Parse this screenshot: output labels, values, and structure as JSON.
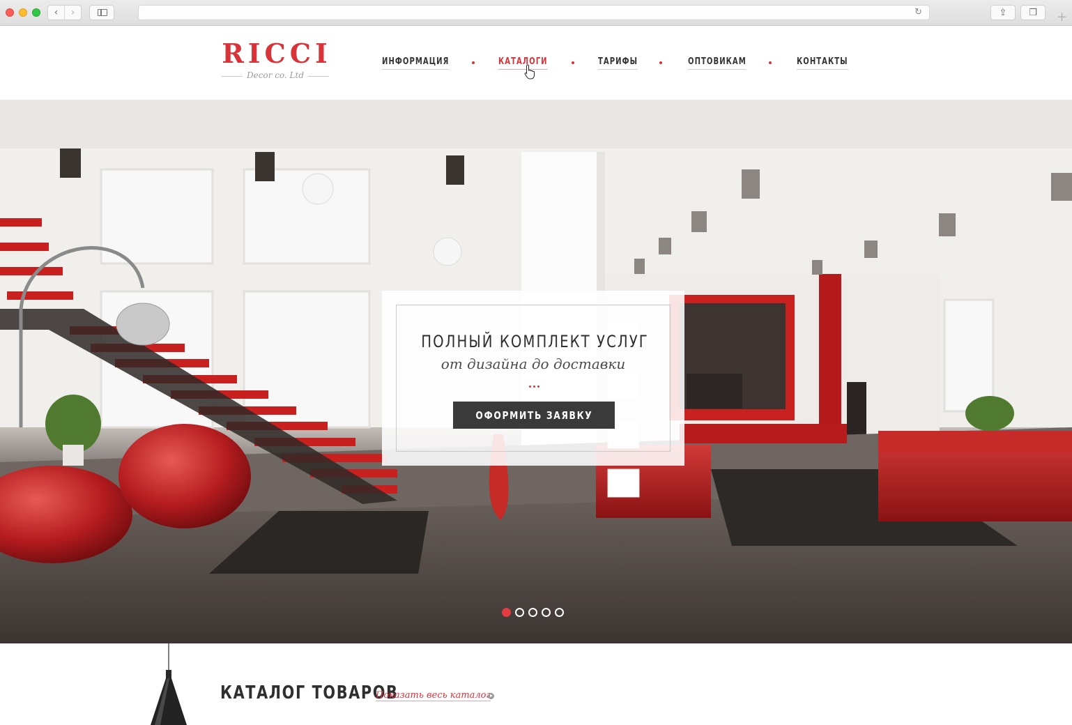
{
  "browser": {
    "address_value": "",
    "nav_back_icon": "chevron-left-icon",
    "nav_forward_icon": "chevron-right-icon",
    "reload_icon": "reload-icon",
    "share_icon": "share-icon",
    "tabs_icon": "tabs-icon",
    "new_tab_icon": "plus-icon"
  },
  "brand": {
    "name": "RICCI",
    "tagline": "Decor co. Ltd",
    "color": "#d9333a"
  },
  "menu": {
    "items": [
      {
        "label": "ИНФОРМАЦИЯ"
      },
      {
        "label": "КАТАЛОГИ",
        "active": true
      },
      {
        "label": "ТАРИФЫ"
      },
      {
        "label": "ОПТОВИКАМ"
      },
      {
        "label": "КОНТАКТЫ"
      }
    ]
  },
  "hero": {
    "title": "ПОЛНЫЙ КОМПЛЕКТ УСЛУГ",
    "subtitle": "от дизайна до доставки",
    "cta_label": "ОФОРМИТЬ ЗАЯВКУ",
    "slides_total": 5,
    "active_slide": 1
  },
  "catalog": {
    "title": "КАТАЛОГ ТОВАРОВ",
    "show_all_label": "Показать весь каталог"
  },
  "colors": {
    "accent": "#d9333a",
    "button_dark": "#3a3a3a"
  }
}
